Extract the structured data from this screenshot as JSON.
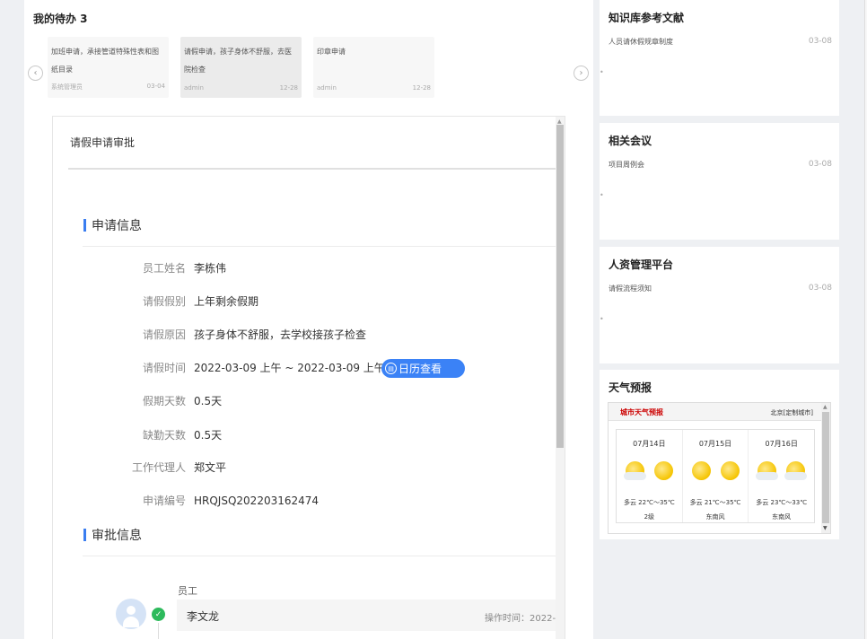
{
  "todo": {
    "title": "我的待办 3",
    "cards": [
      {
        "title": "加班申请，承接管道特殊性表和图纸目录",
        "sender": "系统管理员",
        "date": "03-04"
      },
      {
        "title": "请假申请，孩子身体不舒服，去医院检查",
        "sender": "admin",
        "date": "12-28"
      },
      {
        "title": "印章申请",
        "sender": "admin",
        "date": "12-28"
      }
    ],
    "prev_icon": "chevron-left-icon",
    "next_icon": "chevron-right-icon"
  },
  "form": {
    "title": "请假申请审批",
    "apply_section": "申请信息",
    "approve_section": "审批信息",
    "fields": [
      {
        "label": "员工姓名",
        "value": "李栋伟"
      },
      {
        "label": "请假假别",
        "value": "上年剩余假期"
      },
      {
        "label": "请假原因",
        "value": "孩子身体不舒服，去学校接孩子检查"
      },
      {
        "label": "请假时间",
        "value": "2022-03-09 上午  ~  2022-03-09 上午"
      },
      {
        "label": "假期天数",
        "value": "0.5天"
      },
      {
        "label": "缺勤天数",
        "value": "0.5天"
      },
      {
        "label": "工作代理人",
        "value": "郑文平"
      },
      {
        "label": "申请编号",
        "value": "HRQJSQ202203162474"
      }
    ],
    "calendar_button": "日历查看",
    "approver": {
      "role": "员工",
      "name": "李文龙",
      "time_label": "操作时间：2022-"
    }
  },
  "side": {
    "knowledge": {
      "title": "知识库参考文献",
      "item": "人员请休假规章制度",
      "date": "03-08"
    },
    "meeting": {
      "title": "相关会议",
      "item": "项目周例会",
      "date": "03-08"
    },
    "hr": {
      "title": "人资管理平台",
      "item": "请假流程须知",
      "date": "03-08"
    },
    "weather": {
      "title": "天气预报",
      "bar_left": "城市天气预报",
      "bar_right": "北京[定制城市]",
      "days": [
        {
          "date": "07月14日",
          "temp": "多云 22℃～35℃",
          "wind": "2级"
        },
        {
          "date": "07月15日",
          "temp": "多云 21℃～35℃",
          "wind": "东南风"
        },
        {
          "date": "07月16日",
          "temp": "多云 23℃～33℃",
          "wind": "东南风"
        }
      ]
    }
  },
  "colors": {
    "accent": "#3b82f6",
    "success": "#2dba5c",
    "weather_red": "#cc0000"
  }
}
